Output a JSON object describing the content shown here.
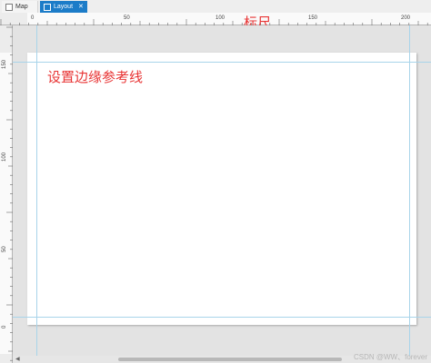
{
  "tabs": [
    {
      "label": "Map",
      "active": false,
      "icon": "map-icon"
    },
    {
      "label": "Layout",
      "active": true,
      "icon": "layout-icon",
      "close": "✕"
    }
  ],
  "ruler_top": {
    "labels": [
      "0",
      "50",
      "100",
      "150",
      "200"
    ]
  },
  "ruler_left": {
    "labels": [
      "150",
      "100",
      "50",
      "0"
    ]
  },
  "annotations": {
    "ruler": "标尺",
    "margin_guides": "设置边缘参考线"
  },
  "scrollbar": {
    "left_arrow": "◀"
  },
  "watermark": "CSDN @WW、forever",
  "colors": {
    "active_tab": "#1c7cc8",
    "annotation": "#e83535",
    "guide": "#a8d4ea"
  }
}
